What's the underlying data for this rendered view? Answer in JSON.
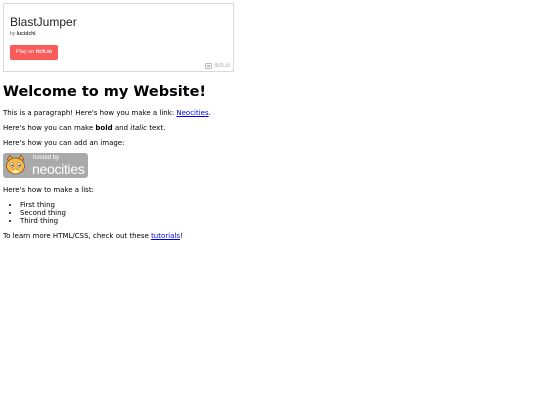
{
  "embed": {
    "title": "BlastJumper",
    "by_prefix": "by",
    "author": "lucidchi",
    "play_prefix": "Play on",
    "play_site": "itch.io",
    "logo_text": "itch.io"
  },
  "page": {
    "heading": "Welcome to my Website!",
    "p1_text": "This is a paragraph! Here's how you make a link:",
    "p1_link": "Neocities",
    "p1_end": ".",
    "p2_start": "Here's how you can make",
    "p2_bold": "bold",
    "p2_mid": "and",
    "p2_italic": "italic",
    "p2_end": "text.",
    "p3_text": "Here's how you can add an image:",
    "badge_small": "hosted by",
    "badge_big": "neocities",
    "p4_text": "Here's how to make a list:",
    "list": [
      "First thing",
      "Second thing",
      "Third thing"
    ],
    "p5_text": "To learn more HTML/CSS, check out these",
    "p5_link": "tutorials",
    "p5_end": "!"
  },
  "colors": {
    "play_button": "#fa5c5c",
    "link": "#0000ee",
    "badge_bg": "#a9a9a9"
  }
}
